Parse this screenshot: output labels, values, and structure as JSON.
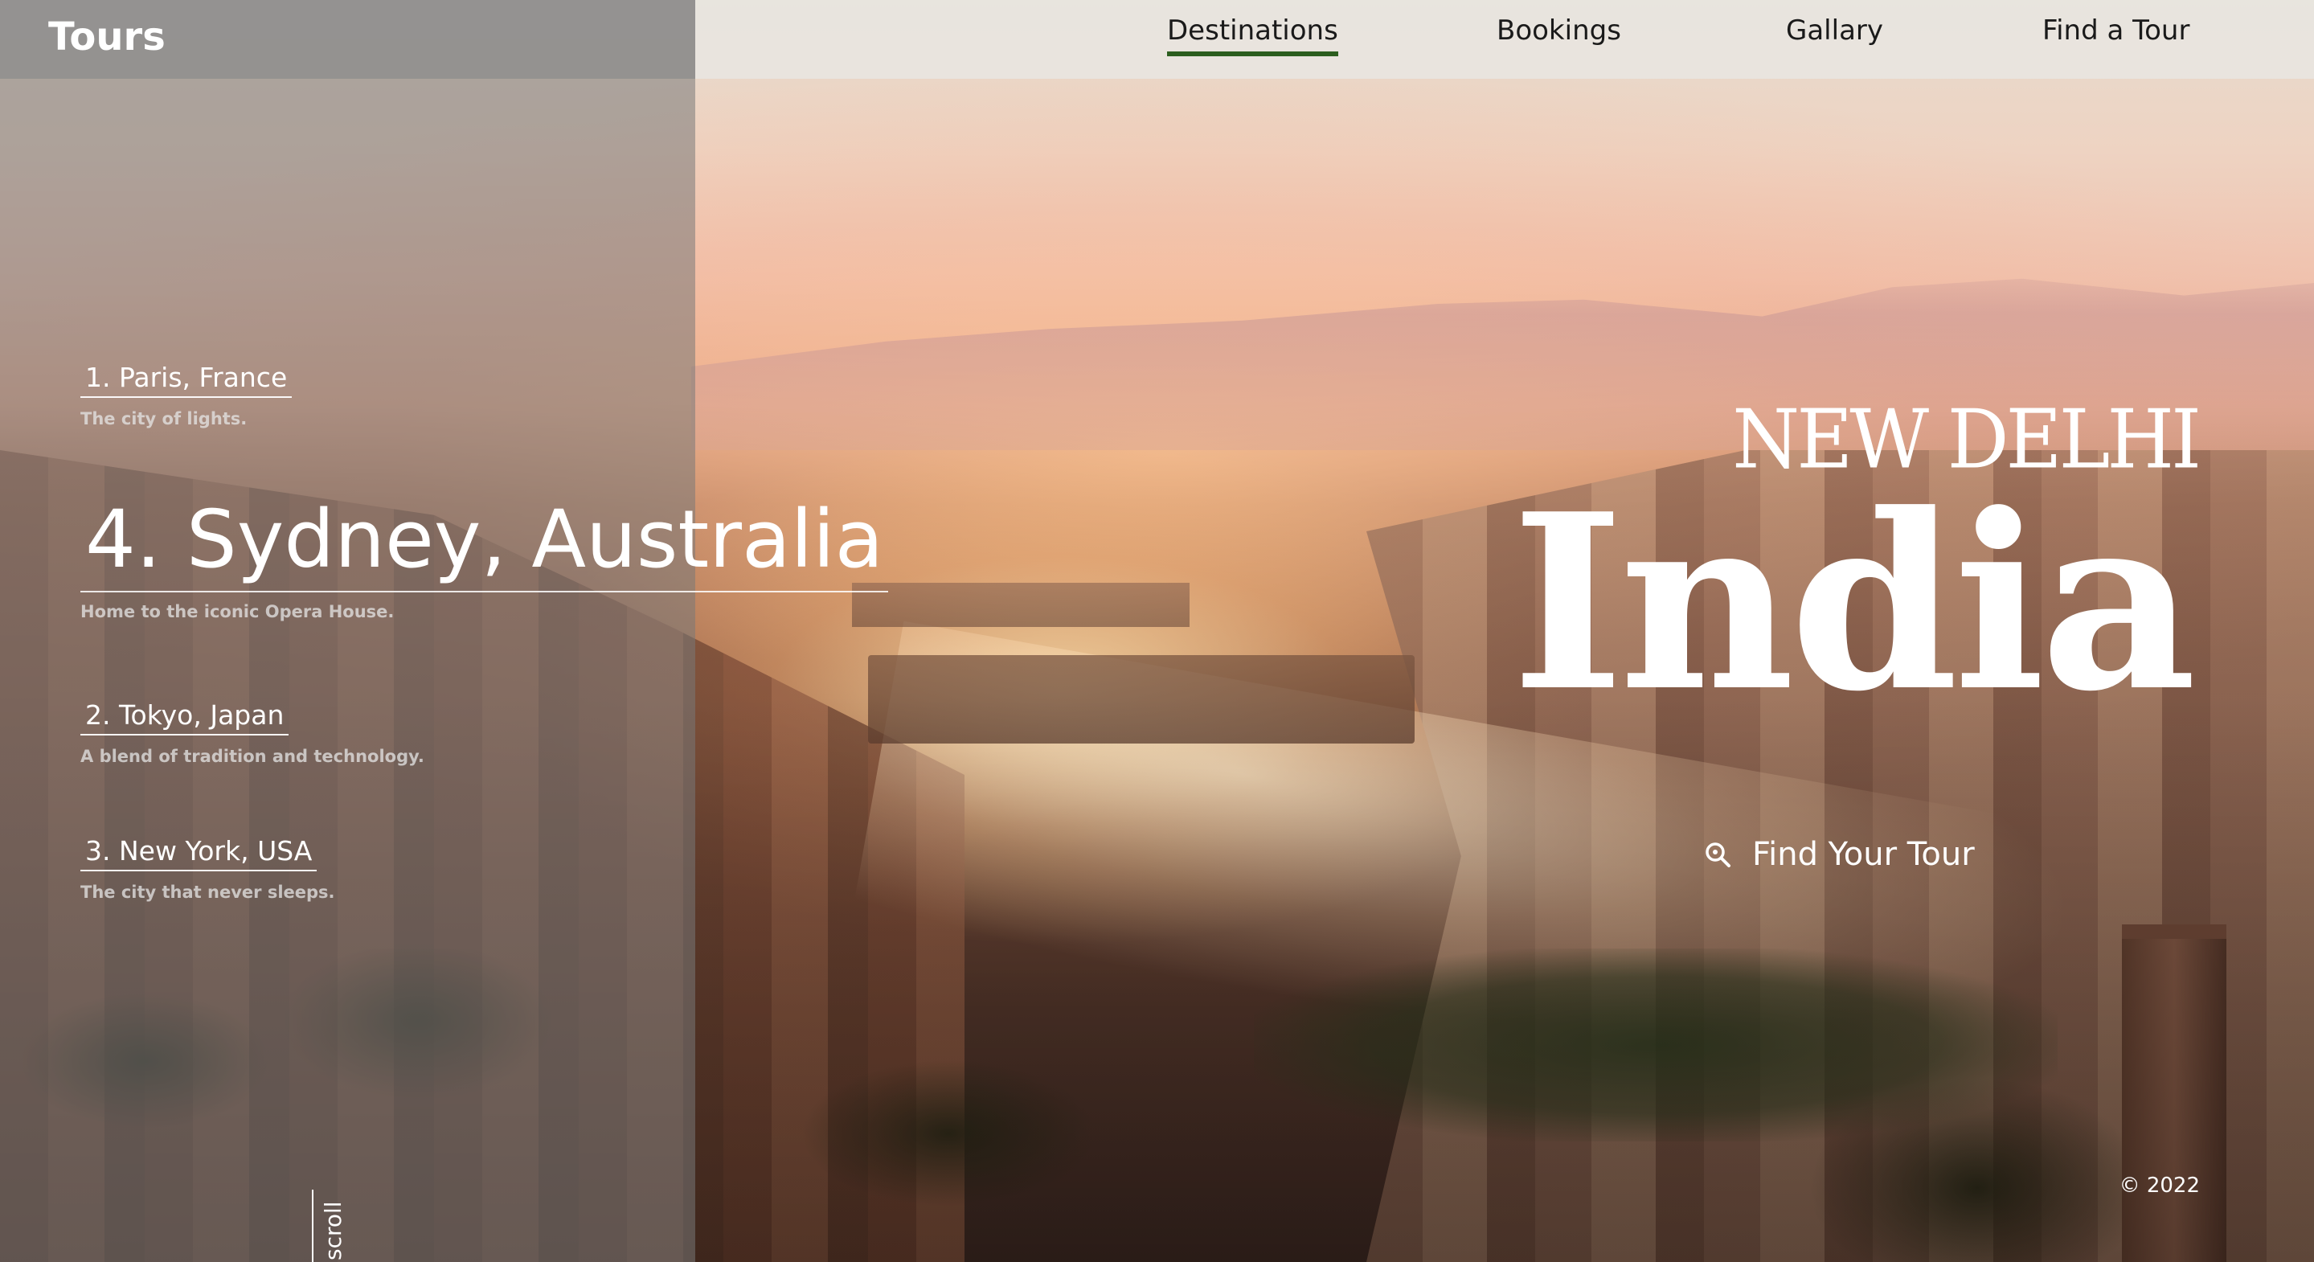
{
  "brand": "Tours",
  "nav": {
    "items": [
      {
        "label": "Destinations",
        "active": true
      },
      {
        "label": "Bookings",
        "active": false
      },
      {
        "label": "Gallary",
        "active": false
      },
      {
        "label": "Find a Tour",
        "active": false
      }
    ]
  },
  "destinations": [
    {
      "title": "1. Paris, France",
      "description": "The city of lights."
    },
    {
      "title": "4. Sydney, Australia",
      "description": "Home to the iconic Opera House.",
      "featured": true
    },
    {
      "title": "2. Tokyo, Japan",
      "description": "A blend of tradition and technology."
    },
    {
      "title": "3. New York, USA",
      "description": "The city that never sleeps."
    }
  ],
  "scroll_label": "scroll",
  "hero": {
    "subtitle": "NEW DELHI",
    "title": "India",
    "cta": {
      "label": "Find Your Tour",
      "icon": "search-icon"
    }
  },
  "footer": {
    "copyright": "© 2022"
  },
  "colors": {
    "nav_active_underline": "#2c5e1f",
    "nav_background": "#e8e5e0",
    "left_panel_overlay": "#787878",
    "text_light": "#ffffff"
  }
}
